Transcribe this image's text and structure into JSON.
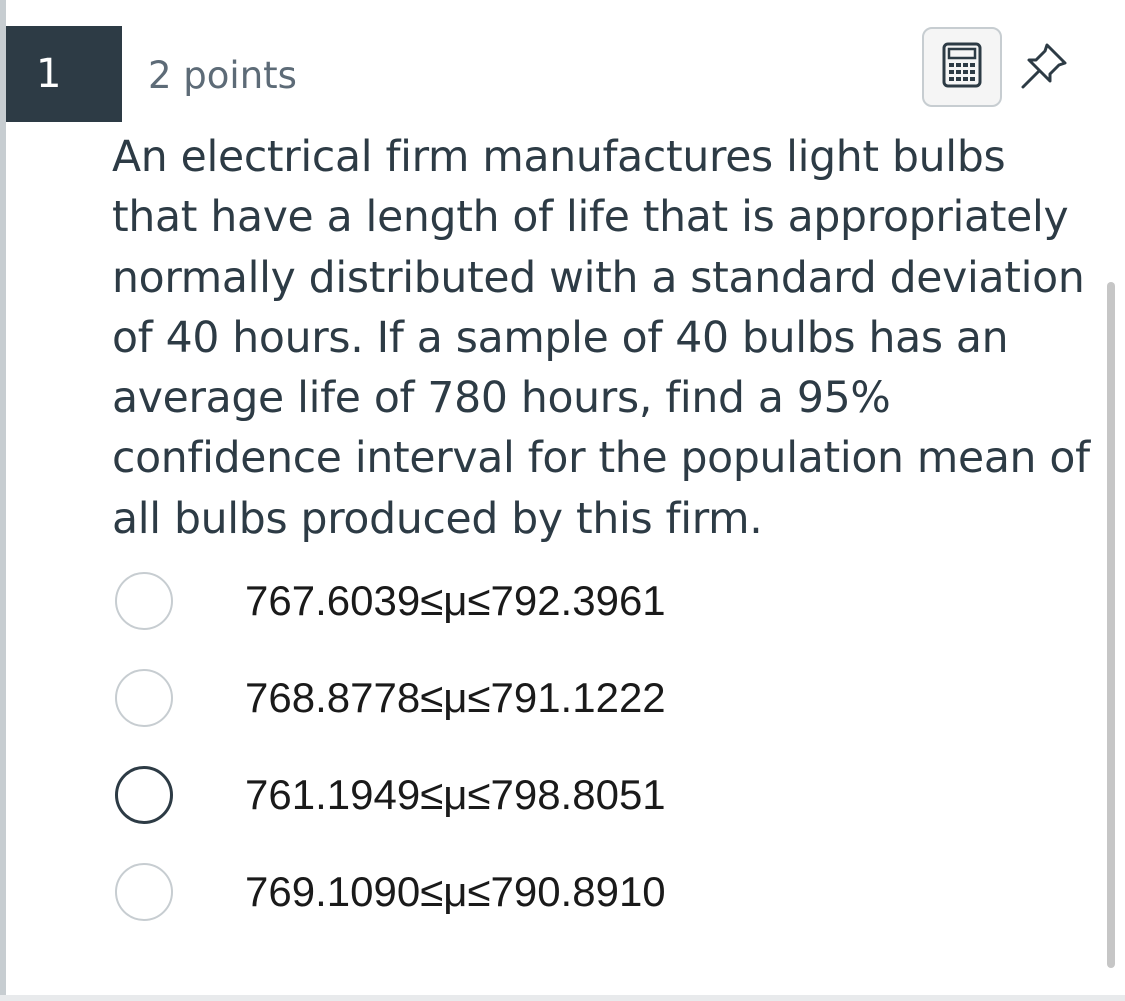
{
  "question": {
    "number": "1",
    "points": "2 points",
    "text": "An electrical firm manufactures light bulbs that have a length of life that is appropriately normally distributed with a standard deviation of 40 hours. If a sample of 40 bulbs has an average life of 780 hours, find a 95% confidence interval for the population mean of all bulbs produced by this firm."
  },
  "answers": [
    {
      "label": "767.6039≤μ≤792.3961"
    },
    {
      "label": "768.8778≤μ≤791.1222"
    },
    {
      "label": "761.1949≤μ≤798.8051"
    },
    {
      "label": "769.1090≤μ≤790.8910"
    }
  ],
  "icons": {
    "calculator": "calculator-icon",
    "pin": "pin-icon"
  },
  "colors": {
    "number_badge": "#2d3b45",
    "text": "#2d3b45",
    "muted": "#5d6b77",
    "radio_border": "#c7cdd1"
  }
}
